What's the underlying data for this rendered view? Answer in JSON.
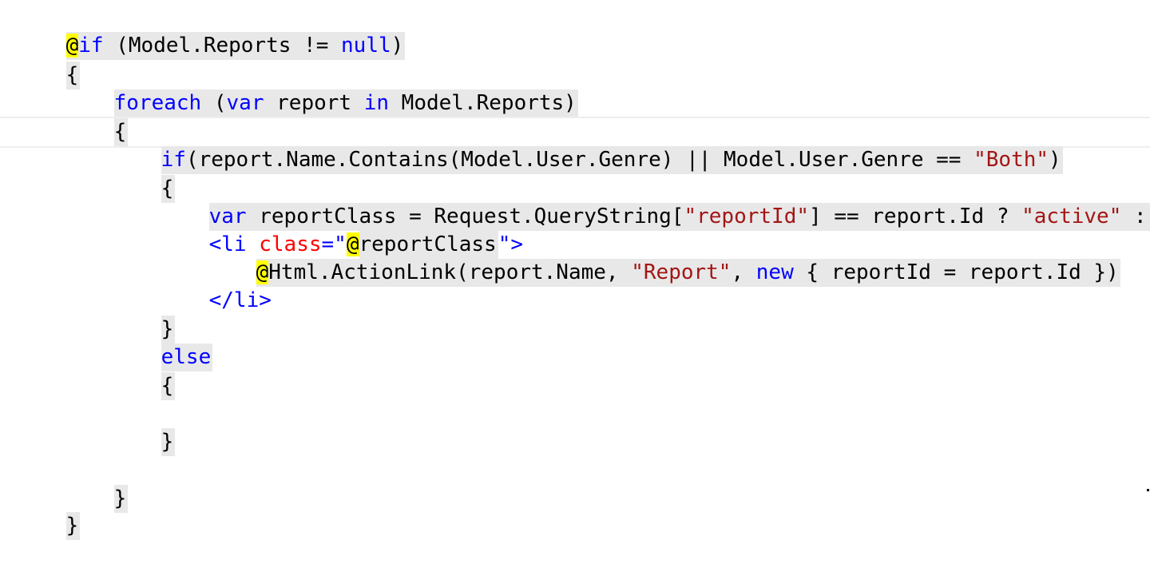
{
  "editor": {
    "lines": {
      "l1": {
        "razor": "@",
        "kw_if": "if",
        "rest": " (Model.Reports != ",
        "kw_null": "null",
        "close": ")"
      },
      "l2": {
        "text": "{"
      },
      "l3": {
        "kw_foreach": "foreach",
        "p1": " (",
        "kw_var": "var",
        "p2": " report ",
        "kw_in": "in",
        "p3": " Model.Reports)"
      },
      "l4": {
        "text": "{"
      },
      "l5": {
        "kw_if": "if",
        "p1": "(report.Name.Contains(Model.User.Genre) || Model.User.Genre == ",
        "str_both": "\"Both\"",
        "p2": ")"
      },
      "l6": {
        "text": "{"
      },
      "l7": {
        "kw_var": "var",
        "p1": " reportClass = Request.QueryString[",
        "str_reportid": "\"reportId\"",
        "p2": "] == report.Id ? ",
        "str_active": "\"active\"",
        "p3": " : ",
        "str_empty": "\"\"",
        "p4": ";"
      },
      "l8": {
        "tag_open": "<li",
        "space": " ",
        "attr_class": "class",
        "eq_quote": "=\"",
        "razor": "@",
        "val": "reportClass",
        "end_quote": "\"",
        "tag_close": ">"
      },
      "l9": {
        "razor": "@",
        "p1": "Html.ActionLink(report.Name, ",
        "str_report": "\"Report\"",
        "p2": ", ",
        "kw_new": "new",
        "p3": " { reportId = report.Id })"
      },
      "l10": {
        "tag": "</li>"
      },
      "l11": {
        "text": "}"
      },
      "l12": {
        "kw_else": "else"
      },
      "l13": {
        "text": "{"
      },
      "l14": {
        "text": "}"
      },
      "l15": {
        "text": "}"
      },
      "l16": {
        "text": "}"
      }
    }
  },
  "colors": {
    "keyword": "#0000ff",
    "string": "#a31515",
    "attribute": "#ff0000",
    "razor_highlight": "#ffff00",
    "code_background": "#e8e8e8"
  }
}
